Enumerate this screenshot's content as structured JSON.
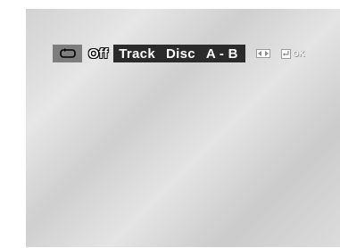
{
  "osd": {
    "repeat_icon": "repeat-icon",
    "current_option": "Off",
    "options": [
      "Track",
      "Disc",
      "A - B"
    ],
    "nav_icon": "left-right-arrows-icon",
    "enter_icon": "enter-icon",
    "ok_label": "OK"
  }
}
